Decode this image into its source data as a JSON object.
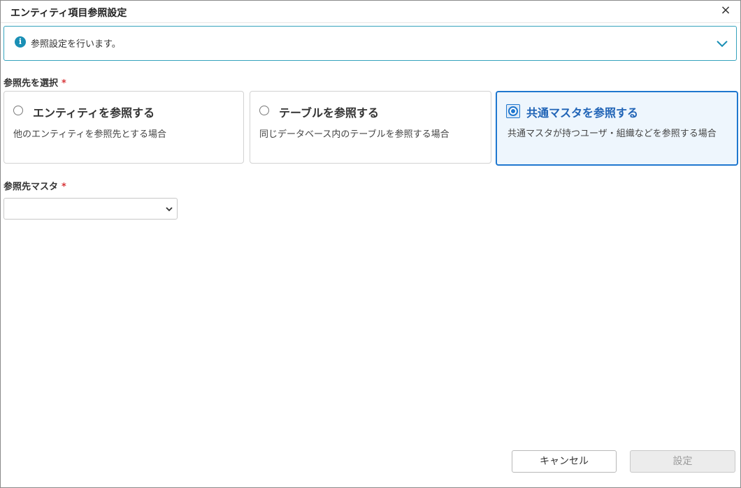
{
  "dialog": {
    "title": "エンティティ項目参照設定",
    "close_icon": "×"
  },
  "info": {
    "icon": "i",
    "text": "参照設定を行います。"
  },
  "reference_target": {
    "label": "参照先を選択",
    "required_mark": "*",
    "options": [
      {
        "title": "エンティティを参照する",
        "description": "他のエンティティを参照先とする場合",
        "selected": false
      },
      {
        "title": "テーブルを参照する",
        "description": "同じデータベース内のテーブルを参照する場合",
        "selected": false
      },
      {
        "title": "共通マスタを参照する",
        "description": "共通マスタが持つユーザ・組織などを参照する場合",
        "selected": true
      }
    ]
  },
  "master_select": {
    "label": "参照先マスタ",
    "required_mark": "*",
    "value": ""
  },
  "footer": {
    "cancel_label": "キャンセル",
    "submit_label": "設定"
  },
  "colors": {
    "accent": "#1f77cf",
    "info_border": "#36a3bd",
    "required": "#d8363a"
  }
}
